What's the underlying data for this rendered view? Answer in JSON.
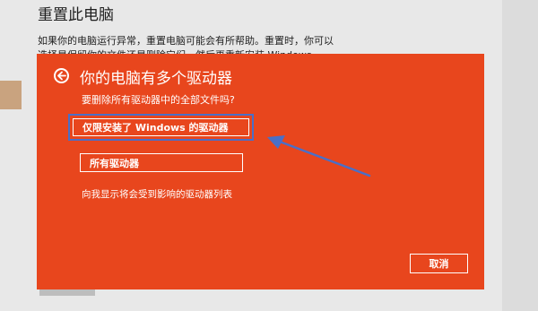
{
  "background": {
    "title": "重置此电脑",
    "text": "如果你的电脑运行异常，重置电脑可能会有所帮助。重置时，你可以选择是保留你的文件还是删除它们，然后再重新安装 Windows。"
  },
  "dialog": {
    "title": "你的电脑有多个驱动器",
    "subtitle": "要删除所有驱动器中的全部文件吗?",
    "option_windows_only": "仅限安装了 Windows 的驱动器",
    "option_all_drives": "所有驱动器",
    "show_drives_link": "向我显示将会受到影响的驱动器列表",
    "cancel_label": "取消",
    "back_icon": "back-arrow-icon"
  },
  "colors": {
    "dialog_background": "#e8461d",
    "highlight_frame": "#4a6fc7",
    "annotation_arrow": "#4a6fc7"
  }
}
